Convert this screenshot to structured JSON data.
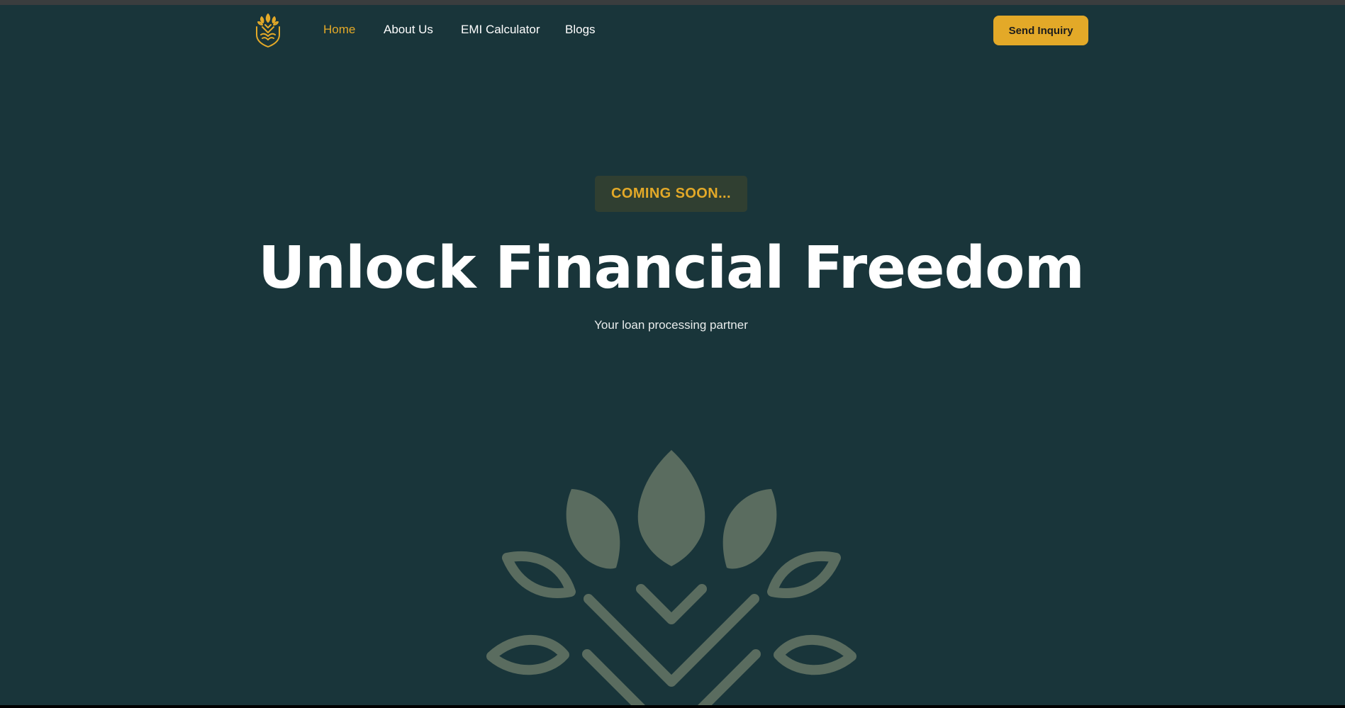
{
  "nav": {
    "logo": "brand-logo-icon",
    "links": [
      {
        "label": "Home",
        "active": true
      },
      {
        "label": "About Us",
        "active": false
      },
      {
        "label": "EMI Calculator",
        "active": false
      },
      {
        "label": "Blogs",
        "active": false
      }
    ],
    "cta_label": "Send Inquiry"
  },
  "hero": {
    "badge": "COMING SOON...",
    "title": "Unlock Financial Freedom",
    "subtitle": "Your loan processing partner",
    "emblem": "leaf-tree-emblem-icon"
  },
  "colors": {
    "background": "#19353a",
    "accent": "#e3a928",
    "badge_bg": "#303f31",
    "emblem": "#5a6c5f",
    "text": "#ffffff"
  }
}
